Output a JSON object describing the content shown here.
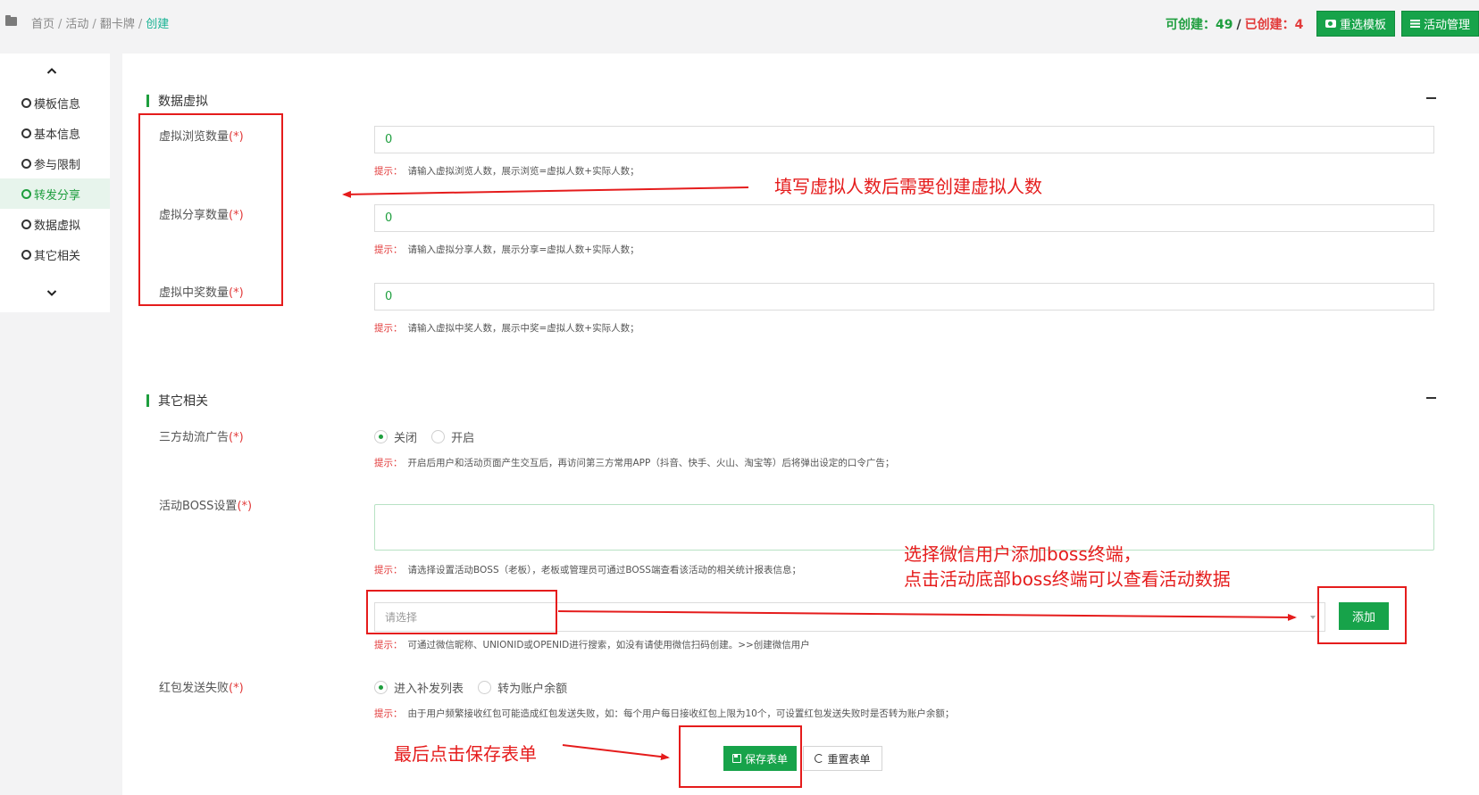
{
  "breadcrumb": {
    "items": [
      "首页",
      "活动",
      "翻卡牌"
    ],
    "current": "创建",
    "separator": "/"
  },
  "counts": {
    "can_label": "可创建：49",
    "slash": "/",
    "done_label": "已创建：4"
  },
  "header_buttons": {
    "reselect_template": "重选模板",
    "activity_manage": "活动管理"
  },
  "sidebar": {
    "items": [
      {
        "label": "模板信息",
        "active": false
      },
      {
        "label": "基本信息",
        "active": false
      },
      {
        "label": "参与限制",
        "active": false
      },
      {
        "label": "转发分享",
        "active": true
      },
      {
        "label": "数据虚拟",
        "active": false
      },
      {
        "label": "其它相关",
        "active": false
      }
    ]
  },
  "section_virtual": {
    "title": "数据虚拟",
    "fields": [
      {
        "label": "虚拟浏览数量",
        "required": "(*)",
        "value": "0",
        "hint_tip": "提示：",
        "hint": "请输入虚拟浏览人数，展示浏览=虚拟人数+实际人数；"
      },
      {
        "label": "虚拟分享数量",
        "required": "(*)",
        "value": "0",
        "hint_tip": "提示：",
        "hint": "请输入虚拟分享人数，展示分享=虚拟人数+实际人数；"
      },
      {
        "label": "虚拟中奖数量",
        "required": "(*)",
        "value": "0",
        "hint_tip": "提示：",
        "hint": "请输入虚拟中奖人数，展示中奖=虚拟人数+实际人数；"
      }
    ]
  },
  "section_other": {
    "title": "其它相关",
    "ad": {
      "label": "三方劫流广告",
      "required": "(*)",
      "options": [
        "关闭",
        "开启"
      ],
      "selected": "关闭",
      "hint_tip": "提示：",
      "hint": "开启后用户和活动页面产生交互后，再访问第三方常用APP（抖音、快手、火山、淘宝等）后将弹出设定的口令广告；"
    },
    "boss": {
      "label": "活动BOSS设置",
      "required": "(*)",
      "hint_tip": "提示：",
      "hint": "请选择设置活动BOSS（老板），老板或管理员可通过BOSS端查看该活动的相关统计报表信息；",
      "select_placeholder": "请选择",
      "add_button": "添加",
      "select_hint_tip": "提示：",
      "select_hint": "可通过微信昵称、UNIONID或OPENID进行搜索，如没有请使用微信扫码创建。>>创建微信用户"
    },
    "redpack": {
      "label": "红包发送失败",
      "required": "(*)",
      "options": [
        "进入补发列表",
        "转为账户余额"
      ],
      "selected": "进入补发列表",
      "hint_tip": "提示：",
      "hint": "由于用户频繁接收红包可能造成红包发送失败，如：每个用户每日接收红包上限为10个，可设置红包发送失败时是否转为账户余额；"
    }
  },
  "form_buttons": {
    "save": "保存表单",
    "reset": "重置表单"
  },
  "annotations": {
    "virtual_note": "填写虚拟人数后需要创建虚拟人数",
    "boss_note_line1": "选择微信用户添加boss终端，",
    "boss_note_line2": "点击活动底部boss终端可以查看活动数据",
    "save_note": "最后点击保存表单"
  },
  "colors": {
    "brand_green": "#17a34a",
    "text_green": "#1e9e3e",
    "required_red": "#e23a3a",
    "annotation_red": "#e51c1c"
  }
}
